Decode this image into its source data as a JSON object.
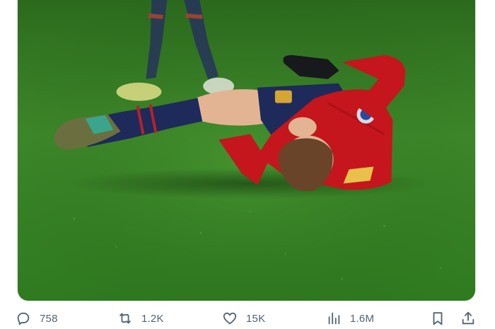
{
  "tweet": {
    "media": {
      "subject": "football-player-injured-on-pitch"
    },
    "actions": {
      "reply": {
        "icon": "reply-icon",
        "count": "758"
      },
      "retweet": {
        "icon": "retweet-icon",
        "count": "1.2K"
      },
      "like": {
        "icon": "heart-icon",
        "count": "15K"
      },
      "views": {
        "icon": "views-chart-icon",
        "count": "1.6M"
      },
      "bookmark": {
        "icon": "bookmark-icon"
      },
      "share": {
        "icon": "share-icon"
      }
    }
  },
  "colors": {
    "icon": "#536471",
    "pitch": "#2f7a1f",
    "kit_red": "#c4161c",
    "kit_navy": "#1d2a5a"
  }
}
